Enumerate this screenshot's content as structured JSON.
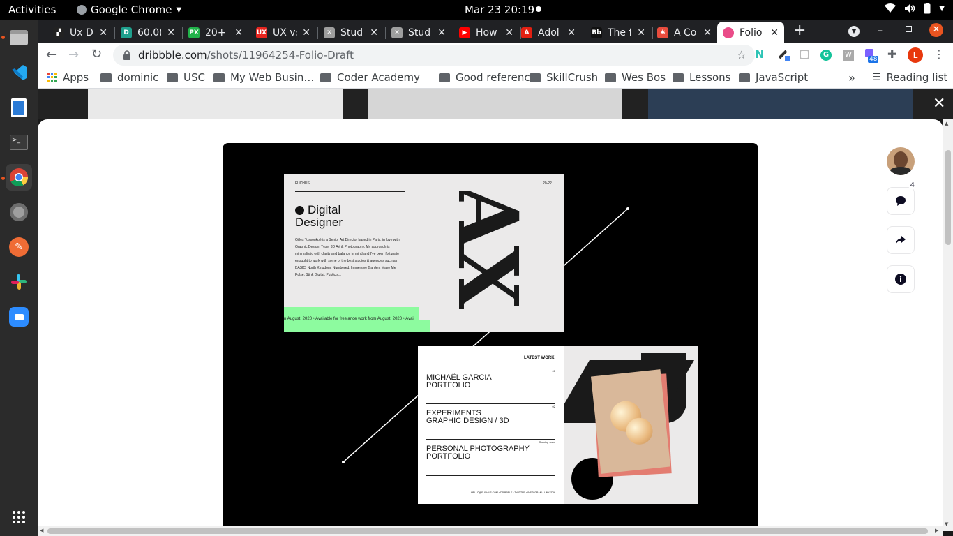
{
  "topbar": {
    "activities": "Activities",
    "app_name": "Google Chrome",
    "clock": "Mar 23  20:19"
  },
  "tabs": [
    {
      "title": "Ux D",
      "favicon_color": "#222222",
      "favicon_glyph": "▞"
    },
    {
      "title": "60,0(",
      "favicon_color": "#1fa08d",
      "favicon_glyph": "D"
    },
    {
      "title": "20+ F",
      "favicon_color": "#21b34a",
      "favicon_glyph": "PX"
    },
    {
      "title": "UX vs",
      "favicon_color": "#e8251f",
      "favicon_glyph": "UX"
    },
    {
      "title": "Stud",
      "favicon_color": "#9e9e9e",
      "favicon_glyph": "✕"
    },
    {
      "title": "Stud",
      "favicon_color": "#9e9e9e",
      "favicon_glyph": "✕"
    },
    {
      "title": "How",
      "favicon_color": "#ff0000",
      "favicon_glyph": "▶"
    },
    {
      "title": "Adol",
      "favicon_color": "#e32012",
      "favicon_glyph": "A"
    },
    {
      "title": "The f",
      "favicon_color": "#111111",
      "favicon_glyph": "Bb"
    },
    {
      "title": "A Co",
      "favicon_color": "#e84c3d",
      "favicon_glyph": "✱"
    },
    {
      "title": "Folio",
      "favicon_color": "#ea4c89",
      "favicon_glyph": ""
    }
  ],
  "address": {
    "host": "dribbble.com",
    "path": "/shots/11964254-Folio-Draft"
  },
  "extensions": {
    "badge_count": "48",
    "profile_initial": "L"
  },
  "bookmarks": {
    "apps": "Apps",
    "folders": [
      "dominic",
      "USC",
      "My Web Busin…",
      "Coder Academy",
      "Good references",
      "SkillCrush",
      "Wes Bos",
      "Lessons",
      "JavaScript"
    ],
    "reading_list": "Reading list"
  },
  "shot": {
    "card1": {
      "brand": "FUCHUS",
      "year": "20-22",
      "heading_line1": "Digital",
      "heading_line2": "Designer",
      "bio": "Gilles Tossoukpé is a Senior Art Director based in Paris, in love with Graphic Design, Type, 3D Art & Photography. My approach is minimalistic with clarity and balance in mind and I've been fortunate enought to work with some of the best studios & agencies such as BASIC, North Kingdom, Numbered, Immersive Garden, Make Me Pulse, Stink Digital, Publicis...",
      "ticker": "n August, 2020  •  Available for freelance work from August, 2020  •  Avail",
      "big_letters": "AX"
    },
    "card2": {
      "header": "LATEST WORK",
      "items": [
        {
          "num": "01",
          "line1": "MICHAËL GARCIA",
          "line2": "PORTFOLIO"
        },
        {
          "num": "02",
          "line1": "EXPERIMENTS",
          "line2": "GRAPHIC DESIGN / 3D"
        },
        {
          "num": "Coming soon",
          "line1": "PERSONAL PHOTOGRAPHY",
          "line2": "PORTFOLIO"
        }
      ],
      "footer": "HELLO@FUCHUS.COM  •  DRIBBBLE  •  TWITTER  •  INSTAGRAM  •  LINKEDIN"
    }
  },
  "side_actions": {
    "comments_count": "4"
  },
  "colors": {
    "ticker_green": "#8dfb9f",
    "dribbble_pink": "#ea4c89",
    "chrome_dark": "#202124"
  }
}
